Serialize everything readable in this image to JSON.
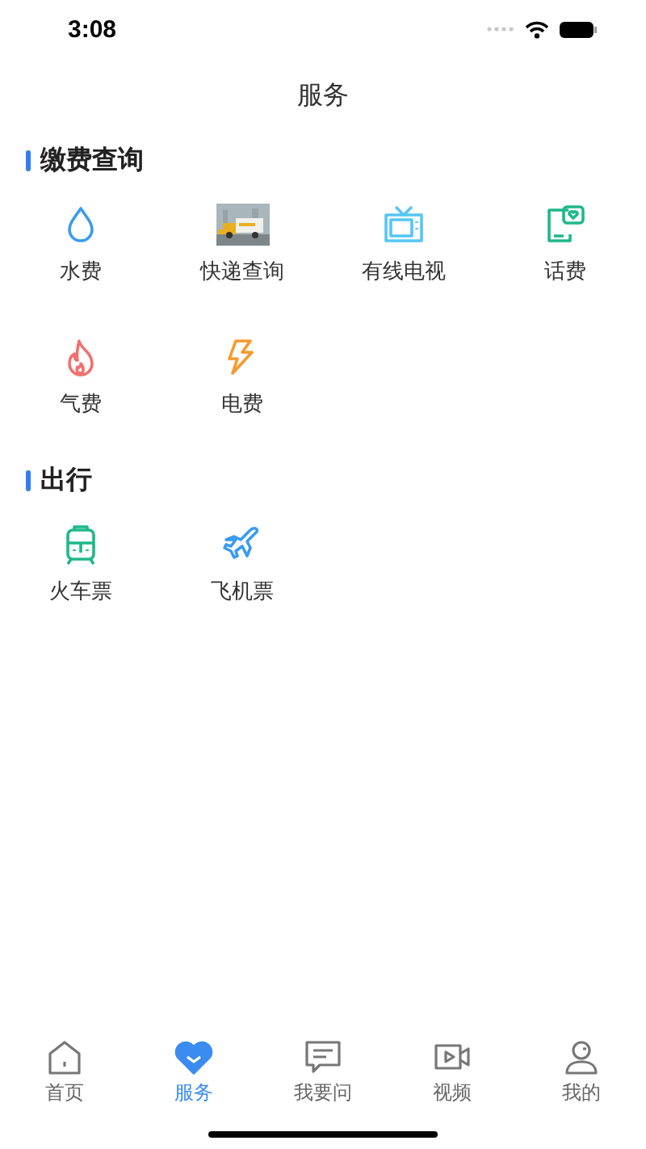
{
  "status_bar": {
    "time": "3:08"
  },
  "title": "服务",
  "sections": [
    {
      "title": "缴费查询",
      "items": [
        {
          "label": "水费",
          "kind": "water"
        },
        {
          "label": "快递查询",
          "kind": "picture"
        },
        {
          "label": "有线电视",
          "kind": "tv"
        },
        {
          "label": "话费",
          "kind": "phone"
        },
        {
          "label": "气费",
          "kind": "gas"
        },
        {
          "label": "电费",
          "kind": "power"
        }
      ]
    },
    {
      "title": "出行",
      "items": [
        {
          "label": "火车票",
          "kind": "train"
        },
        {
          "label": "飞机票",
          "kind": "plane"
        }
      ]
    }
  ],
  "tabs": [
    {
      "label": "首页",
      "kind": "home",
      "selected": false
    },
    {
      "label": "服务",
      "kind": "heart",
      "selected": true
    },
    {
      "label": "我要问",
      "kind": "chat",
      "selected": false
    },
    {
      "label": "视频",
      "kind": "video",
      "selected": false
    },
    {
      "label": "我的",
      "kind": "user",
      "selected": false
    }
  ]
}
